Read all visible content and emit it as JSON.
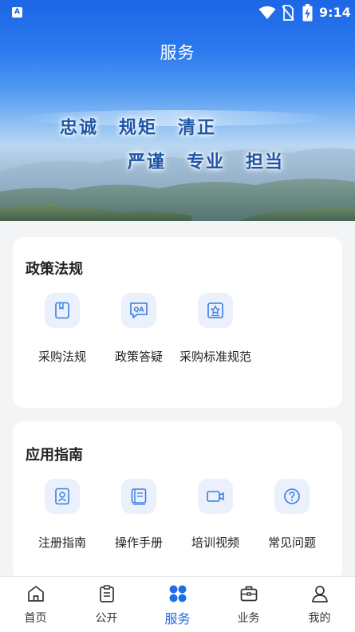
{
  "status_bar": {
    "app_badge": "A",
    "time": "9:14"
  },
  "header": {
    "title": "服务"
  },
  "banner": {
    "slogan_line1": [
      "忠诚",
      "规矩",
      "清正"
    ],
    "slogan_line2": [
      "严谨",
      "专业",
      "担当"
    ]
  },
  "policy_section": {
    "title": "政策法规",
    "items": [
      {
        "label": "采购法规",
        "icon": "book-icon"
      },
      {
        "label": "政策答疑",
        "icon": "qa-icon"
      },
      {
        "label": "采购标准规范",
        "icon": "standard-badge-icon"
      }
    ]
  },
  "guide_section": {
    "title": "应用指南",
    "items": [
      {
        "label": "注册指南",
        "icon": "user-card-icon"
      },
      {
        "label": "操作手册",
        "icon": "manual-icon"
      },
      {
        "label": "培训视频",
        "icon": "video-camera-icon"
      },
      {
        "label": "常见问题",
        "icon": "question-circle-icon"
      }
    ]
  },
  "tabbar": {
    "active": "服务",
    "tabs": [
      {
        "label": "首页",
        "icon": "home-icon"
      },
      {
        "label": "公开",
        "icon": "clipboard-icon"
      },
      {
        "label": "服务",
        "icon": "service-grid-icon"
      },
      {
        "label": "业务",
        "icon": "briefcase-icon"
      },
      {
        "label": "我的",
        "icon": "person-icon"
      }
    ]
  },
  "colors": {
    "primary": "#1e6fe6",
    "icon_bg": "#eaf1fc",
    "icon_stroke": "#3a7de0"
  }
}
